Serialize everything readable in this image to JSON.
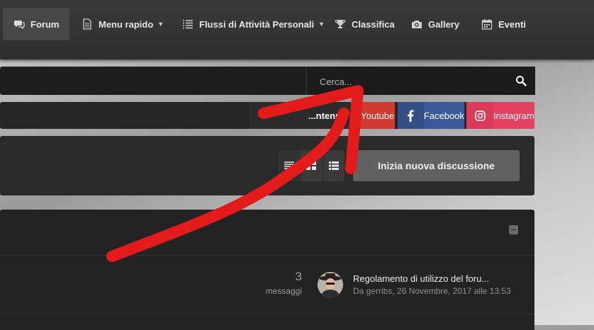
{
  "nav": {
    "forum": "Forum",
    "menu_rapido": "Menu rapido",
    "flussi": "Flussi di Attività Personali",
    "classifica": "Classifica",
    "gallery": "Gallery",
    "eventi": "Eventi"
  },
  "search": {
    "placeholder": "Cerca..."
  },
  "social": {
    "contenuti_partial": "...ntenuti",
    "youtube": "Youtube",
    "facebook": "Facebook",
    "instagram": "Instagram"
  },
  "toolbar": {
    "new_topic": "Inizia nuova discussione"
  },
  "topic": {
    "count": "3",
    "count_label": "messaggi",
    "last_title": "Regolamento di utilizzo del foru...",
    "last_meta": "Da gerribs, 26 Novembre, 2017 alle 13:53"
  },
  "colors": {
    "youtube": "#d13a31",
    "facebook": "#3b5998",
    "instagram": "#e4405f",
    "annotation_arrow": "#e31b1b"
  }
}
